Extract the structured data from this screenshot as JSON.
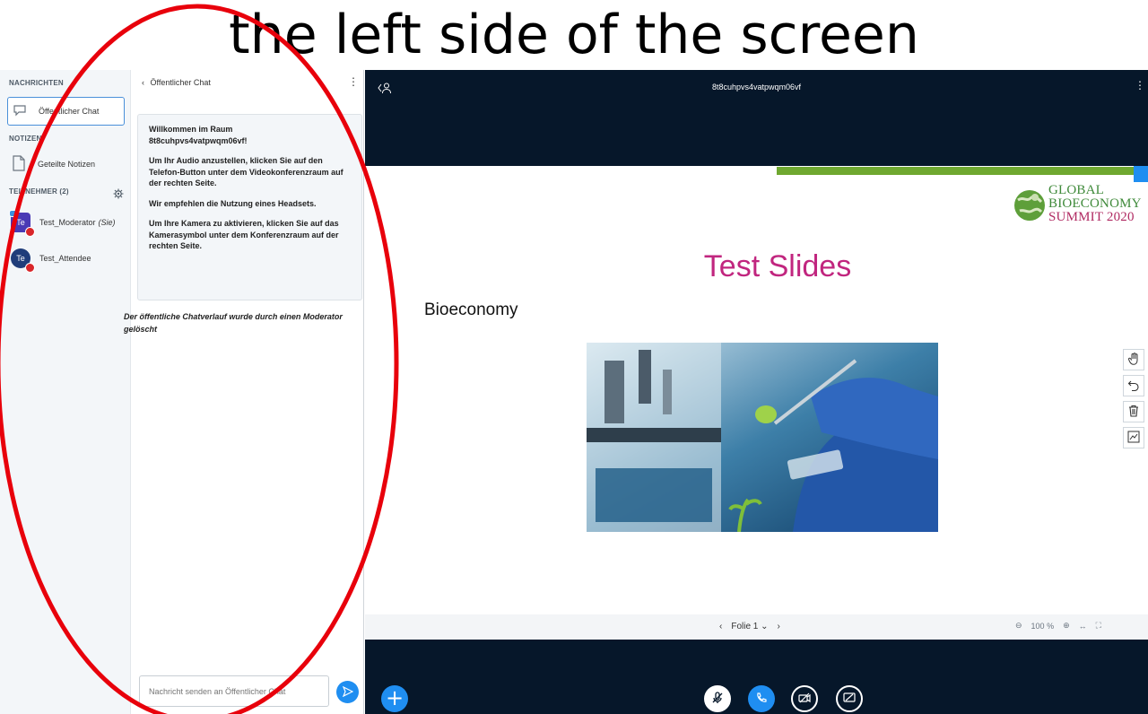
{
  "heading": "the left side of the screen",
  "sidebar": {
    "messages_label": "NACHRICHTEN",
    "public_chat_label": "Öffentlicher Chat",
    "notes_label": "NOTIZEN",
    "shared_notes_label": "Geteilte Notizen",
    "participants_label": "TEILNEHMER (2)",
    "users": [
      {
        "initials": "Te",
        "name": "Test_Moderator",
        "self_suffix": "(Sie)"
      },
      {
        "initials": "Te",
        "name": "Test_Attendee"
      }
    ]
  },
  "chat": {
    "header": "Öffentlicher Chat",
    "welcome_title": "Willkommen im Raum",
    "welcome_room": "8t8cuhpvs4vatpwqm06vf!",
    "welcome_p1": "Um Ihr Audio anzustellen, klicken Sie auf den Telefon-Button unter dem Videokonferenzraum auf der rechten Seite.",
    "welcome_p2": "Wir empfehlen die Nutzung eines Headsets.",
    "welcome_p3": "Um Ihre Kamera zu aktivieren, klicken Sie auf das Kamerasymbol unter dem Konferenzraum auf der rechten Seite.",
    "cleared_msg": "Der öffentliche Chatverlauf wurde durch einen Moderator gelöscht",
    "input_placeholder": "Nachricht senden an Öffentlicher Chat"
  },
  "main": {
    "room_title": "8t8cuhpvs4vatpwqm06vf"
  },
  "slide": {
    "title": "Test Slides",
    "subtitle": "Bioeconomy",
    "logo_line1": "GLOBAL",
    "logo_line2": "BIOECONOMY",
    "logo_line3": "SUMMIT 2020"
  },
  "navbar": {
    "slide_label": "Folie 1",
    "zoom": "100 %"
  },
  "colors": {
    "dark_bg": "#06172a",
    "accent_blue": "#1f8ef1",
    "slide_title": "#c1267f",
    "annotation_red": "#e8000b"
  }
}
